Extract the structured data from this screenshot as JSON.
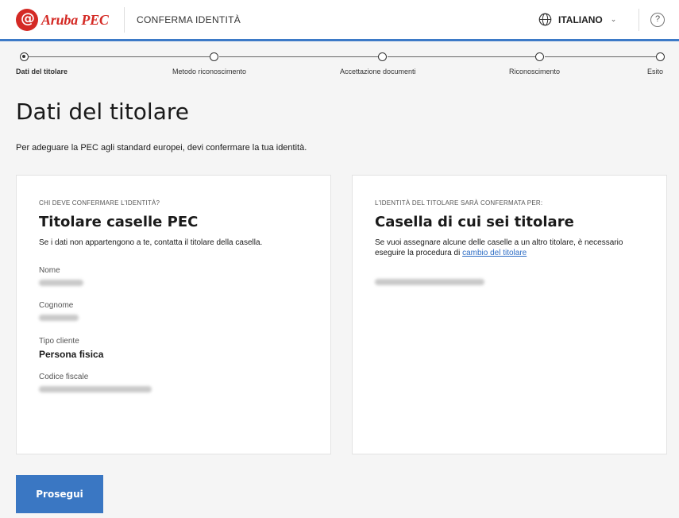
{
  "header": {
    "brand": "Aruba PEC",
    "title": "CONFERMA IDENTITÀ",
    "language": "ITALIANO",
    "help_symbol": "?"
  },
  "stepper": {
    "steps": [
      {
        "label": "Dati del titolare",
        "active": true
      },
      {
        "label": "Metodo riconoscimento",
        "active": false
      },
      {
        "label": "Accettazione documenti",
        "active": false
      },
      {
        "label": "Riconoscimento",
        "active": false
      },
      {
        "label": "Esito",
        "active": false
      }
    ]
  },
  "page": {
    "title": "Dati del titolare",
    "intro": "Per adeguare la PEC agli standard europei, devi confermare la tua identità."
  },
  "left_card": {
    "eyebrow": "CHI DEVE CONFERMARE L'IDENTITÀ?",
    "title": "Titolare caselle PEC",
    "description": "Se i dati non appartengono a te, contatta il titolare della casella.",
    "fields": {
      "nome_label": "Nome",
      "cognome_label": "Cognome",
      "tipo_cliente_label": "Tipo cliente",
      "tipo_cliente_value": "Persona fisica",
      "codice_fiscale_label": "Codice fiscale"
    }
  },
  "right_card": {
    "eyebrow": "L'IDENTITÀ DEL TITOLARE SARÀ CONFERMATA PER:",
    "title": "Casella di cui sei titolare",
    "description": "Se vuoi assegnare alcune delle caselle a un altro titolare, è necessario eseguire la procedura di",
    "link": "cambio del titolare"
  },
  "actions": {
    "continue": "Prosegui"
  },
  "colors": {
    "accent": "#3a77c3",
    "brand_red": "#d42a25",
    "link": "#2f6ec5"
  },
  "icons": [
    "aruba-logo-icon",
    "globe-icon",
    "chevron-down-icon",
    "help-icon"
  ]
}
